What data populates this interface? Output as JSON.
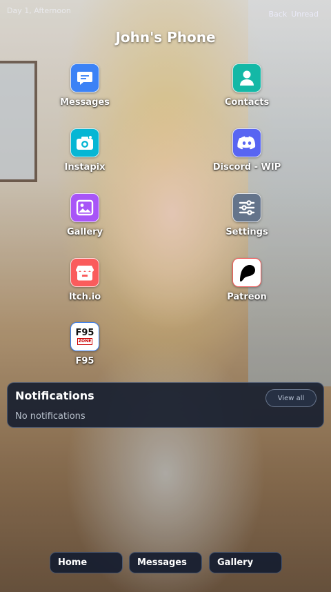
{
  "status": {
    "time": "Day 1, Afternoon",
    "right_items": [
      "Back",
      "Unread"
    ]
  },
  "phone": {
    "title": "John's Phone"
  },
  "apps": [
    {
      "label": "Messages",
      "icon": "chat-bubble-icon",
      "color": "#3b82f6"
    },
    {
      "label": "Contacts",
      "icon": "person-icon",
      "color": "#14b8a6"
    },
    {
      "label": "Instapix",
      "icon": "camera-icon",
      "color": "#06b6d4"
    },
    {
      "label": "Discord - WIP",
      "icon": "discord-icon",
      "color": "#5865f2"
    },
    {
      "label": "Gallery",
      "icon": "image-icon",
      "color": "#a855f7"
    },
    {
      "label": "Settings",
      "icon": "sliders-icon",
      "color": "#64748b"
    },
    {
      "label": "Itch.io",
      "icon": "itch-store-icon",
      "color": "#fa5c5c"
    },
    {
      "label": "Patreon",
      "icon": "patreon-icon",
      "color": "#ffffff"
    },
    {
      "label": "F95",
      "icon": "f95-zone-icon",
      "color": "#ffffff",
      "icon_text": "F95",
      "icon_subtext": "ZONE"
    }
  ],
  "notifications": {
    "title": "Notifications",
    "view_all_label": "View all",
    "empty_text": "No notifications"
  },
  "nav": [
    {
      "label": "Home"
    },
    {
      "label": "Messages"
    },
    {
      "label": "Gallery"
    }
  ]
}
